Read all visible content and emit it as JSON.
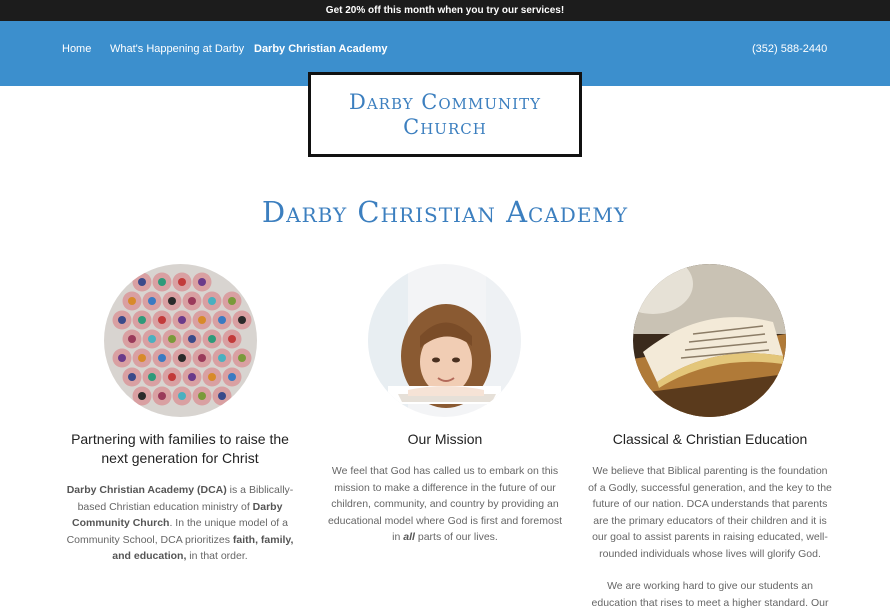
{
  "promo": "Get 20% off this month when you try our services!",
  "nav": {
    "home": "Home",
    "happening": "What's Happening at Darby",
    "academy": "Darby Christian Academy",
    "phone": "(352) 588-2440"
  },
  "logo": {
    "line1": "Darby Community",
    "line2": "Church"
  },
  "page_title": "Darby Christian Academy",
  "col1": {
    "heading": "Partnering with families to raise the next generation for Christ",
    "p1_b1": "Darby Christian Academy (DCA)",
    "p1_t1": " is a Biblically-based Christian education ministry of ",
    "p1_b2": "Darby Community Church",
    "p1_t2": ".  In the unique model of a Community School, DCA prioritizes ",
    "p1_b3": "faith, family, and education,",
    "p1_t3": " in that order."
  },
  "col2": {
    "heading": "Our Mission",
    "p1_t1": "We feel that God has called us to embark on this mission to make a difference in the future of our children, community, and country by providing an educational model where God is first and foremost in ",
    "p1_em": "all",
    "p1_t2": " parts of our lives."
  },
  "col3": {
    "heading": "Classical & Christian Education",
    "p1": "We believe that Biblical parenting is the foundation of a Godly, successful generation, and the key to the future of our nation.  DCA understands that parents are the primary educators of their children and it is our goal to assist parents in raising educated, well-rounded individuals whose lives will glorify God.",
    "p2": "We are working hard to give our students an education that rises to meet a higher standard.  Our"
  }
}
